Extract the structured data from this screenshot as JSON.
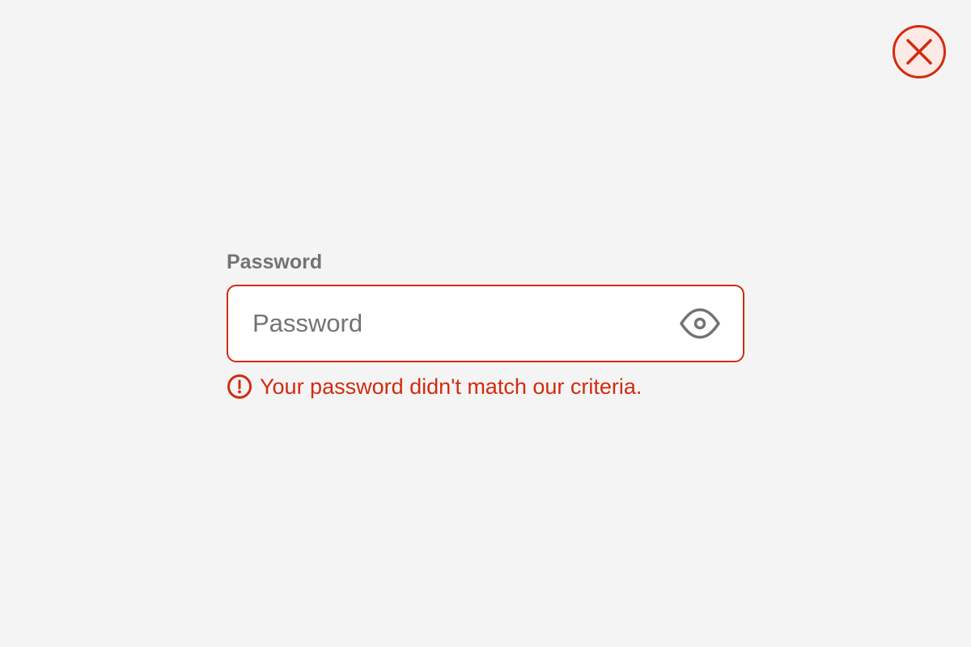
{
  "close": {
    "label": "Close",
    "icon": "close-circle-icon",
    "color": "#d42a0e",
    "fill": "#fde9e6"
  },
  "password_field": {
    "label": "Password",
    "placeholder": "Password",
    "value": "",
    "visibility_toggle": {
      "label": "Show password",
      "icon": "eye-icon"
    },
    "error": {
      "icon": "alert-circle-icon",
      "message": "Your password didn't match our criteria."
    }
  },
  "colors": {
    "background": "#f4f4f4",
    "error": "#d42a0e",
    "label": "#737373",
    "input_background": "#ffffff"
  }
}
